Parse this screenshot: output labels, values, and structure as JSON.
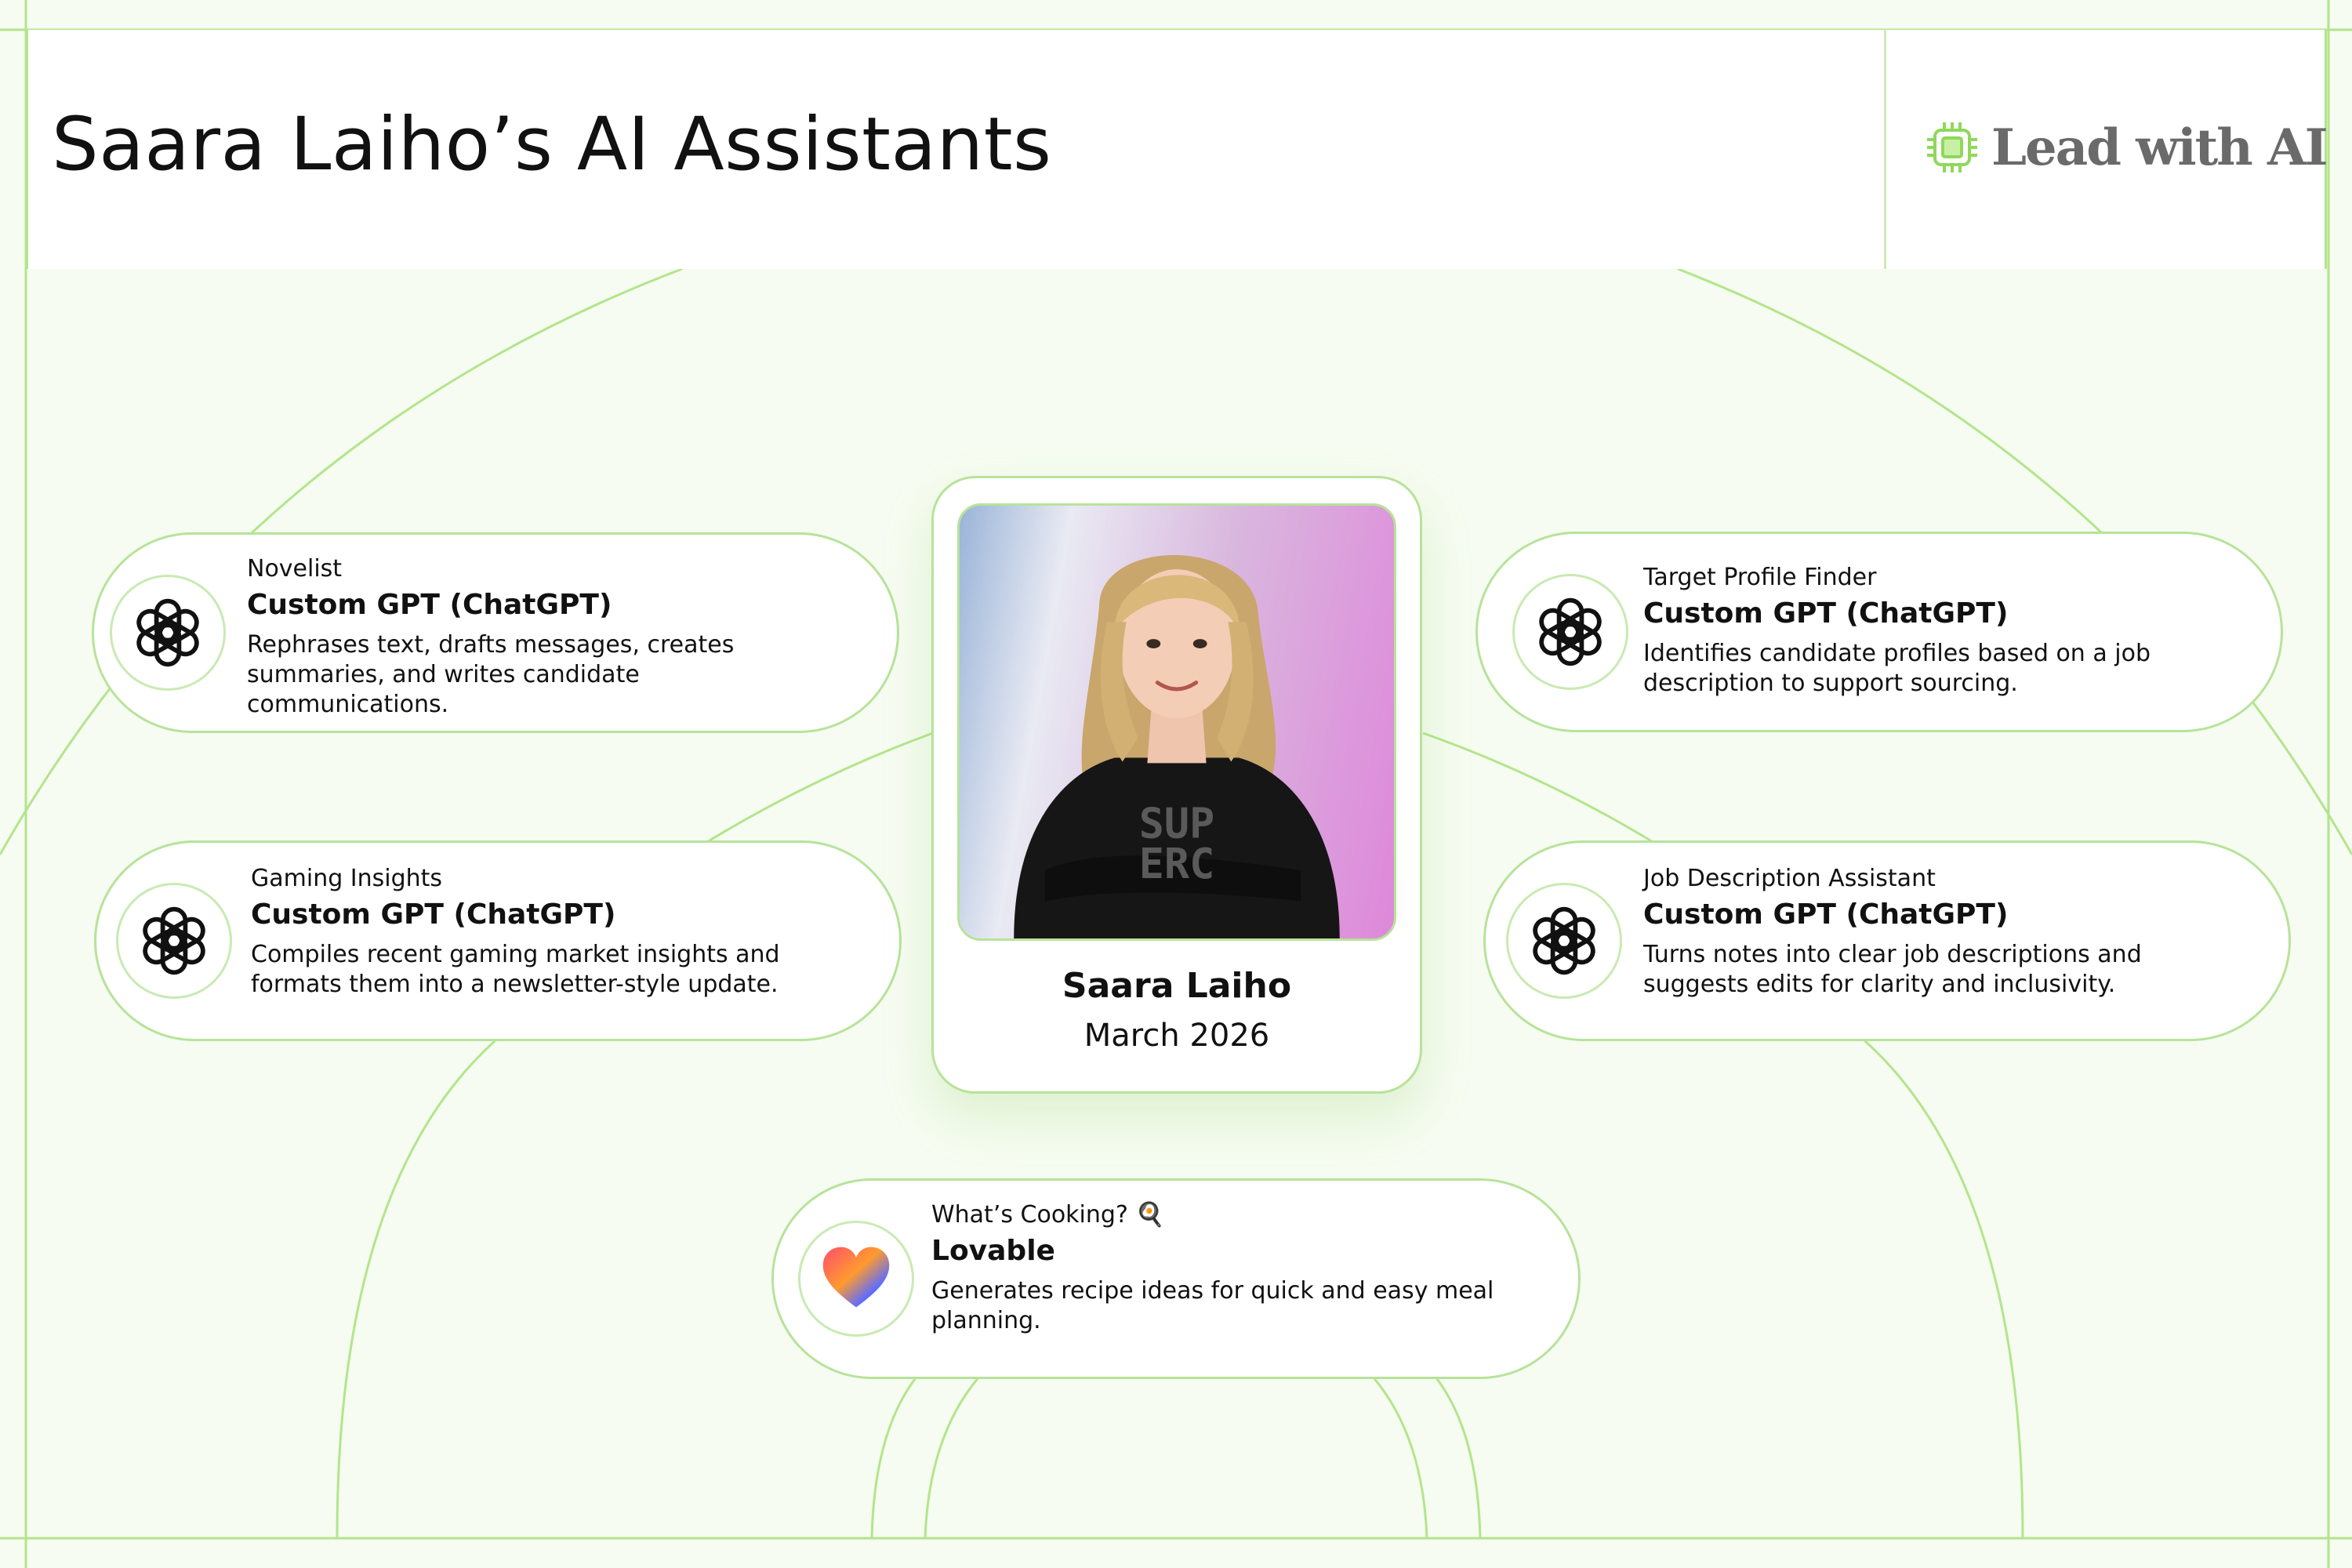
{
  "page": {
    "title": "Saara Laiho’s AI Assistants",
    "brand": "Lead with AI"
  },
  "profile": {
    "name": "Saara Laiho",
    "date": "March 2026",
    "shirt_text": [
      "SUP",
      "ERC"
    ]
  },
  "assistants": [
    {
      "name": "Novelist",
      "tool": "Custom GPT (ChatGPT)",
      "description": "Rephrases text, drafts messages, creates summaries, and writes candidate communications.",
      "icon": "openai-icon"
    },
    {
      "name": "Gaming Insights",
      "tool": "Custom GPT (ChatGPT)",
      "description": "Compiles recent gaming market insights and formats them into a newsletter-style update.",
      "icon": "openai-icon"
    },
    {
      "name": "Target Profile Finder",
      "tool": "Custom GPT (ChatGPT)",
      "description": "Identifies candidate profiles based on a job description to support sourcing.",
      "icon": "openai-icon"
    },
    {
      "name": "Job Description Assistant",
      "tool": "Custom GPT (ChatGPT)",
      "description": "Turns notes into clear job descriptions and suggests edits for clarity and inclusivity.",
      "icon": "openai-icon"
    },
    {
      "name": "What’s Cooking? 🍳",
      "tool": "Lovable",
      "description": "Generates recipe ideas for quick and easy meal planning.",
      "icon": "lovable-heart-icon"
    }
  ],
  "colors": {
    "background": "#f6fcf1",
    "accent_line": "#b3e58c",
    "brand_green": "#8fd85a",
    "brand_text": "#6a6a6a"
  }
}
